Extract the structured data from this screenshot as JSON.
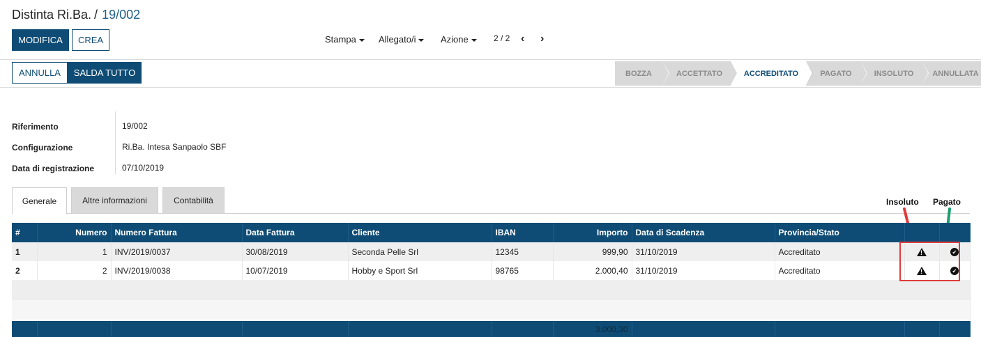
{
  "breadcrumb": {
    "parent": "Distinta Ri.Ba.",
    "separator": "/",
    "current": "19/002"
  },
  "toolbar": {
    "edit_label": "MODIFICA",
    "create_label": "CREA",
    "print_label": "Stampa",
    "attachment_label": "Allegato/i",
    "action_label": "Azione",
    "pager": "2 / 2",
    "prev_icon": "‹",
    "next_icon": "›"
  },
  "actions": {
    "cancel_label": "ANNULLA",
    "settle_all_label": "SALDA TUTTO"
  },
  "statusbar": {
    "stages": [
      "BOZZA",
      "ACCETTATO",
      "ACCREDITATO",
      "PAGATO",
      "INSOLUTO",
      "ANNULLATA"
    ],
    "active": "ACCREDITATO"
  },
  "fields": {
    "riferimento_label": "Riferimento",
    "riferimento_value": "19/002",
    "configurazione_label": "Configurazione",
    "configurazione_value": "Ri.Ba. Intesa Sanpaolo SBF",
    "data_label": "Data di registrazione",
    "data_value": "07/10/2019"
  },
  "tabs": [
    "Generale",
    "Altre informazioni",
    "Contabilità"
  ],
  "legend": {
    "insoluto": "Insoluto",
    "pagato": "Pagato"
  },
  "table": {
    "headers": [
      "#",
      "Numero",
      "Numero Fattura",
      "Data Fattura",
      "Cliente",
      "IBAN",
      "Importo",
      "Data di Scadenza",
      "Provincia/Stato"
    ],
    "rows": [
      {
        "idx": "1",
        "numero": "1",
        "fattura": "INV/2019/0037",
        "data": "30/08/2019",
        "cliente": "Seconda Pelle Srl",
        "iban": "12345",
        "importo": "999,90",
        "scadenza": "31/10/2019",
        "stato": "Accreditato"
      },
      {
        "idx": "2",
        "numero": "2",
        "fattura": "INV/2019/0038",
        "data": "10/07/2019",
        "cliente": "Hobby e Sport Srl",
        "iban": "98765",
        "importo": "2.000,40",
        "scadenza": "31/10/2019",
        "stato": "Accreditato"
      }
    ],
    "total": "3.000,30"
  },
  "colors": {
    "primary": "#0f4c75",
    "annotation_red": "#e03c3c",
    "annotation_green": "#1a9e6e"
  }
}
